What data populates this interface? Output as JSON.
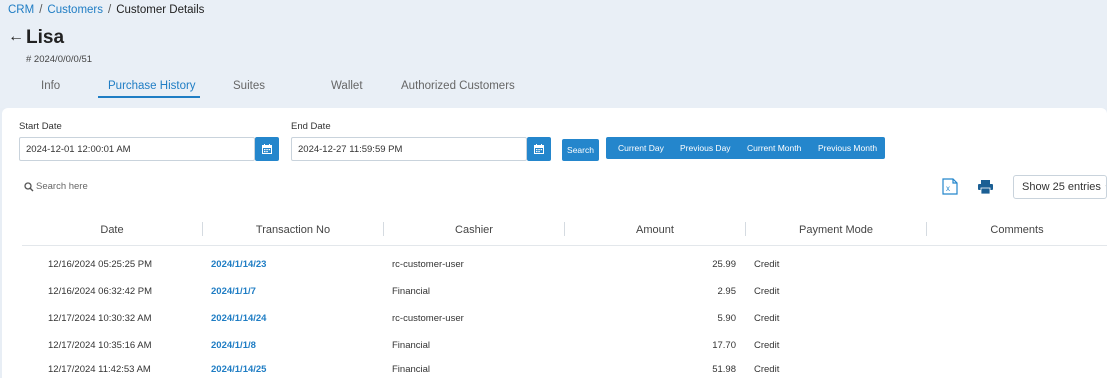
{
  "breadcrumb": {
    "crm": "CRM",
    "customers": "Customers",
    "current": "Customer Details",
    "sep": "/"
  },
  "customer": {
    "back_icon": "back-arrow-icon",
    "name": "Lisa",
    "id": "# 2024/0/0/0/51"
  },
  "tabs": [
    {
      "label": "Info",
      "active": false
    },
    {
      "label": "Purchase History",
      "active": true
    },
    {
      "label": "Suites",
      "active": false
    },
    {
      "label": "Wallet",
      "active": false
    },
    {
      "label": "Authorized Customers",
      "active": false
    }
  ],
  "filters": {
    "start_label": "Start Date",
    "start_value": "2024-12-01 12:00:01 AM",
    "end_label": "End Date",
    "end_value": "2024-12-27 11:59:59 PM",
    "search_button": "Search",
    "quick": [
      "Current Day",
      "Previous Day",
      "Current Month",
      "Previous Month"
    ]
  },
  "toolbar": {
    "search_placeholder": "Search here",
    "show_entries": "Show 25 entries",
    "excel_icon": "excel-export-icon",
    "print_icon": "print-icon"
  },
  "table": {
    "columns": [
      "Date",
      "Transaction No",
      "Cashier",
      "Amount",
      "Payment Mode",
      "Comments"
    ],
    "rows": [
      {
        "date": "12/16/2024 05:25:25 PM",
        "txn": "2024/1/14/23",
        "cashier": "rc-customer-user",
        "amount": "25.99",
        "mode": "Credit",
        "comments": ""
      },
      {
        "date": "12/16/2024 06:32:42 PM",
        "txn": "2024/1/1/7",
        "cashier": "Financial",
        "amount": "2.95",
        "mode": "Credit",
        "comments": ""
      },
      {
        "date": "12/17/2024 10:30:32 AM",
        "txn": "2024/1/14/24",
        "cashier": "rc-customer-user",
        "amount": "5.90",
        "mode": "Credit",
        "comments": ""
      },
      {
        "date": "12/17/2024 10:35:16 AM",
        "txn": "2024/1/1/8",
        "cashier": "Financial",
        "amount": "17.70",
        "mode": "Credit",
        "comments": ""
      },
      {
        "date": "12/17/2024 11:42:53 AM",
        "txn": "2024/1/14/25",
        "cashier": "Financial",
        "amount": "51.98",
        "mode": "Credit",
        "comments": ""
      }
    ]
  },
  "colors": {
    "accent": "#2486cc",
    "link": "#1f7dc4",
    "header_bg": "#e9eff6"
  }
}
